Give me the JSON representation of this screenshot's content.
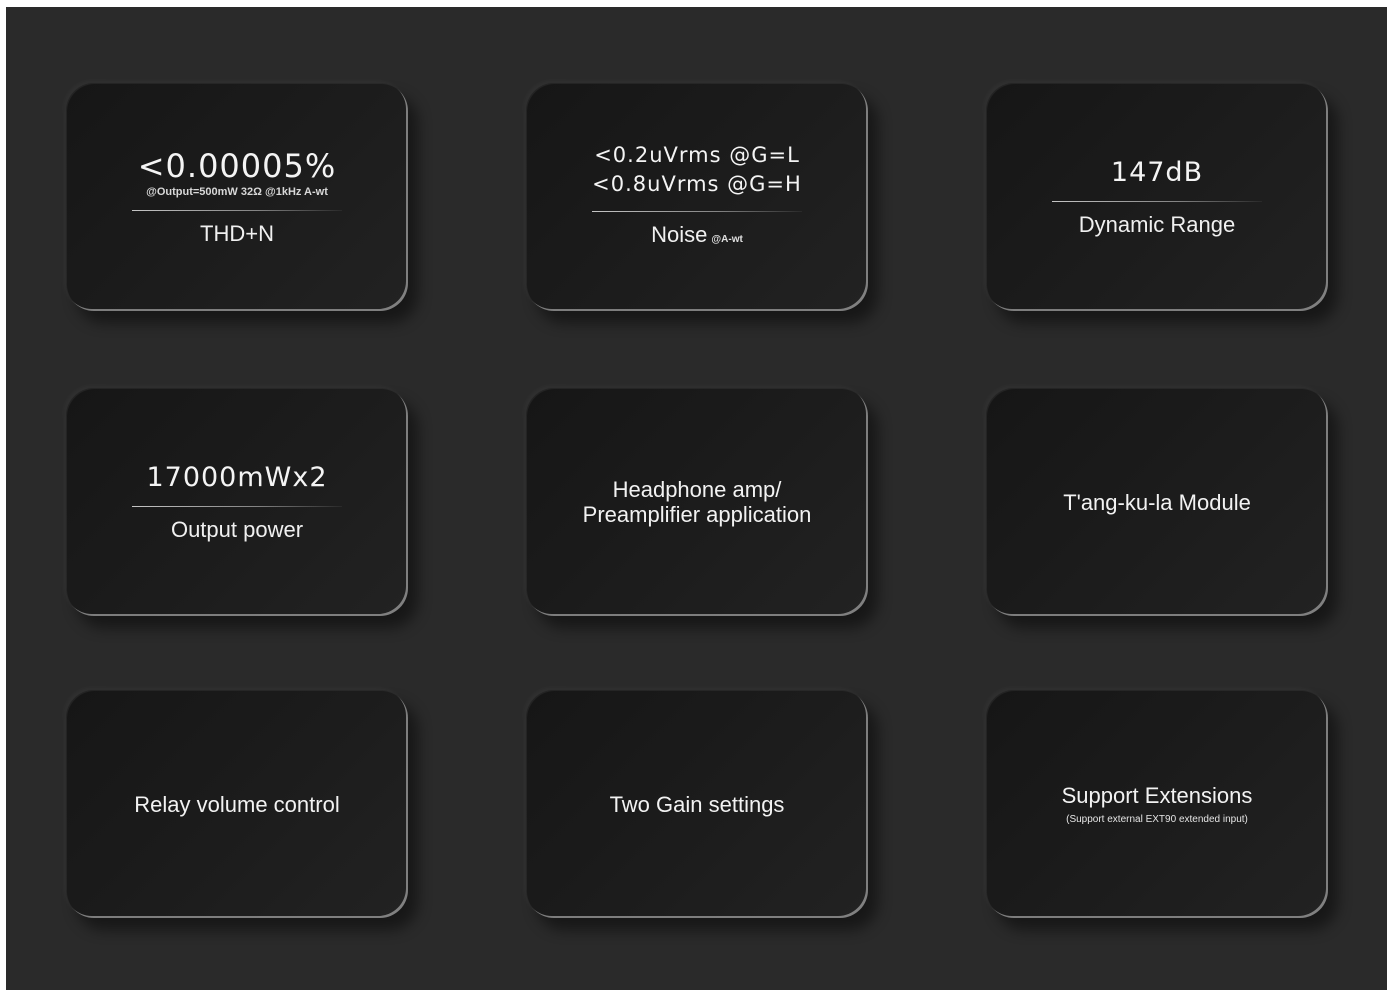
{
  "cards": {
    "thd": {
      "value": "<0.00005%",
      "note": "@Output=500mW 32Ω @1kHz A-wt",
      "label": "THD+N"
    },
    "noise": {
      "value_line1": "<0.2uVrms @G=L",
      "value_line2": "<0.8uVrms @G=H",
      "label": "Noise",
      "label_sub": "@A-wt"
    },
    "dynamic_range": {
      "value": "147dB",
      "label": "Dynamic Range"
    },
    "output_power": {
      "value": "17000mWx2",
      "label": "Output power"
    },
    "application": {
      "line1": "Headphone amp/",
      "line2": "Preamplifier application"
    },
    "module": {
      "text": "T'ang-ku-la Module"
    },
    "relay": {
      "text": "Relay volume control"
    },
    "gain": {
      "text": "Two Gain settings"
    },
    "extensions": {
      "text": "Support Extensions",
      "note": "(Support external EXT90 extended input)"
    }
  }
}
